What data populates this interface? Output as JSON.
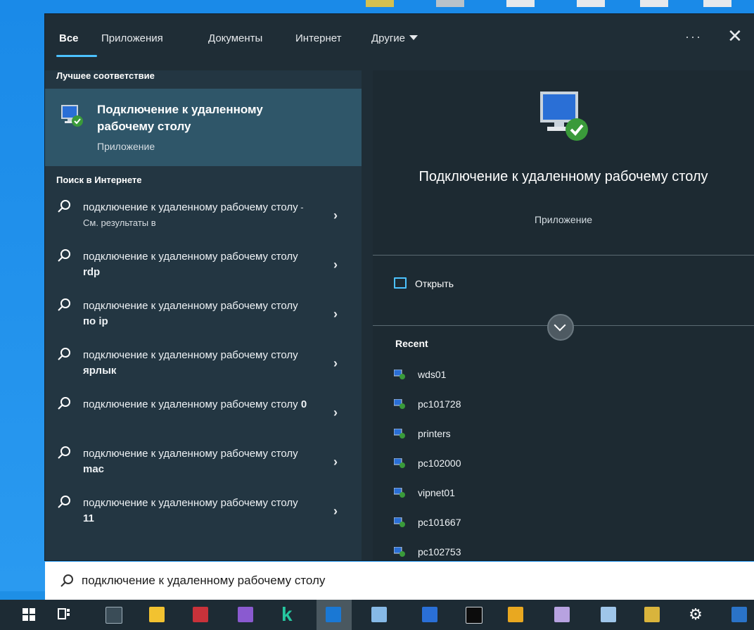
{
  "tabs": [
    {
      "label": "Все",
      "active": true
    },
    {
      "label": "Приложения"
    },
    {
      "label": "Документы"
    },
    {
      "label": "Интернет"
    },
    {
      "label": "Другие"
    }
  ],
  "header": {
    "more": "···",
    "close": "✕"
  },
  "best_match": {
    "section": "Лучшее соответствие",
    "title": "Подключение к удаленному рабочему столу",
    "subtitle": "Приложение"
  },
  "web": {
    "section": "Поиск в Интернете",
    "items": [
      {
        "prefix": "подключение к удаленному рабочему столу",
        "bold": "",
        "tail": " - См. результаты в"
      },
      {
        "prefix": "подключение к удаленному рабочему столу ",
        "bold": "rdp",
        "tail": ""
      },
      {
        "prefix": "подключение к удаленному рабочему столу ",
        "bold": "по ip",
        "tail": ""
      },
      {
        "prefix": "подключение к удаленному рабочему столу ",
        "bold": "ярлык",
        "tail": ""
      },
      {
        "prefix": "подключение к удаленному рабочему столу ",
        "bold": "0",
        "tail": ""
      },
      {
        "prefix": "подключение к удаленному рабочему столу ",
        "bold": "mac",
        "tail": ""
      },
      {
        "prefix": "подключение к удаленному рабочему столу ",
        "bold": "11",
        "tail": ""
      }
    ]
  },
  "preview": {
    "title": "Подключение к удаленному рабочему столу",
    "subtitle": "Приложение",
    "open_label": "Открыть",
    "recent_label": "Recent",
    "recent": [
      "wds01",
      "pc101728",
      "printers",
      "pc102000",
      "vipnet01",
      "pc101667",
      "pc102753"
    ]
  },
  "search": {
    "value": "подключение к удаленному рабочему столу"
  },
  "colors": {
    "accent": "#4cc2ff",
    "panel": "#1f2d36",
    "selected": "#2f5669"
  },
  "taskbar": [
    "windows-start-icon",
    "task-view-icon",
    "terminal-icon",
    "file-explorer-icon",
    "toolbox-icon",
    "visual-studio-icon",
    "kaspersky-icon",
    "outlook-icon",
    "app-icon",
    "remote-desktop-icon",
    "console-icon",
    "key-icon",
    "network-icon",
    "server-manager-icon",
    "remote-app-icon",
    "settings-icon",
    "powershell-icon"
  ]
}
